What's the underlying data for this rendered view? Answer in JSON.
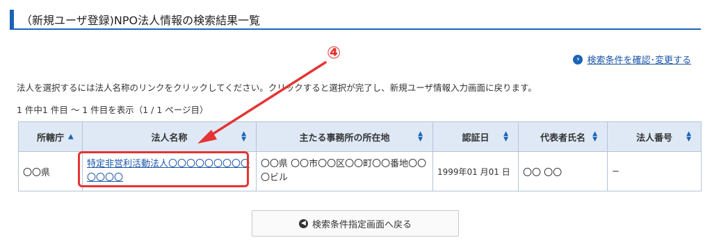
{
  "header": {
    "title": "（新規ユーザ登録)NPO法人情報の検索結果一覧"
  },
  "annotation": {
    "number": "④"
  },
  "change_conditions_link": "検索条件を確認･変更する",
  "instruction": "法人を選択するには法人名称のリンクをクリックしてください。クリックすると選択が完了し、新規ユーザ情報入力画面に戻ります。",
  "result_count": "1 件中1 件目 〜 1 件目を表示（1 / 1 ページ目）",
  "table": {
    "headers": [
      "所轄庁",
      "法人名称",
      "主たる事務所の所在地",
      "認証日",
      "代表者氏名",
      "法人番号"
    ],
    "rows": [
      {
        "agency": "〇〇県",
        "name": "特定非営利活動法人〇〇〇〇〇〇〇〇〇〇〇〇〇",
        "address": "〇〇県 〇〇市〇〇区〇〇町〇〇番地〇〇〇ビル",
        "date": "1999年01 月01 日",
        "representative": "〇〇 〇〇",
        "corp_number": "−"
      }
    ]
  },
  "back_button": "検索条件指定画面へ戻る",
  "colors": {
    "accent": "#1a64b4",
    "header_bg": "#dfe9f6",
    "annotation": "#e53333",
    "link": "#1a55a8"
  }
}
